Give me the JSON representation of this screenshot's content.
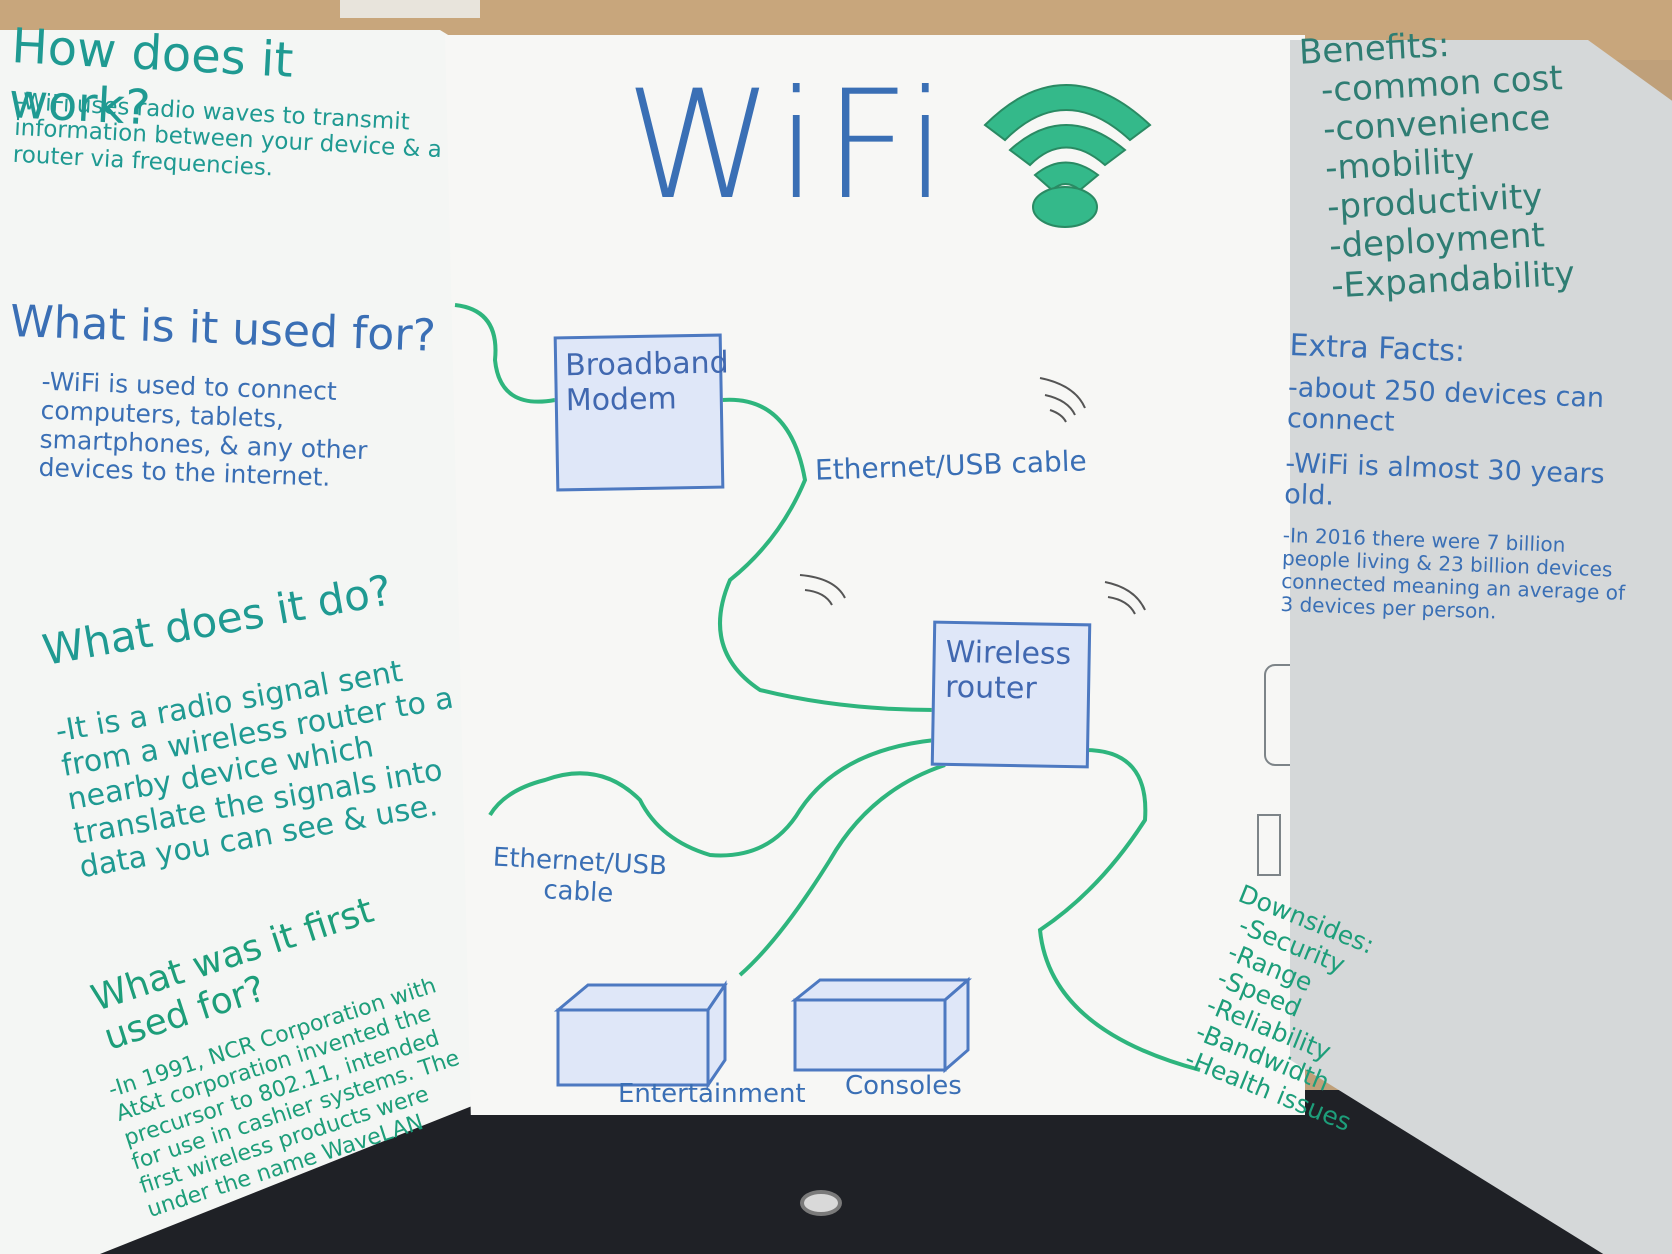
{
  "board": {
    "title": "WiFi",
    "left_panel": {
      "sections": [
        {
          "heading": "How does it work?",
          "body": "-WiFi uses radio waves to transmit information between your device & a router via frequencies."
        },
        {
          "heading": "What is it used for?",
          "body": "-WiFi is used to connect computers, tablets, smartphones, & any other devices to the internet."
        },
        {
          "heading": "What does it do?",
          "body": "-It is a radio signal sent from a wireless router to a nearby device which translate the signals into data you can see & use."
        },
        {
          "heading": "What was it first used for?",
          "body": "-In 1991, NCR Corporation with At&t corporation invented the precursor to 802.11, intended for use in cashier systems. The first wireless products were under the name WaveLAN"
        }
      ]
    },
    "diagram": {
      "nodes": [
        {
          "id": "modem",
          "label": "Broadband\nModem"
        },
        {
          "id": "router",
          "label": "Wireless\nrouter"
        },
        {
          "id": "entertainment",
          "label": "Entertainment"
        },
        {
          "id": "consoles",
          "label": "Consoles"
        }
      ],
      "cable_labels": [
        "Ethernet/USB cable",
        "Ethernet/USB\ncable"
      ]
    },
    "right_panel": {
      "benefits_heading": "Benefits:",
      "benefits": [
        "-common cost",
        "-convenience",
        "-mobility",
        "-productivity",
        "-deployment",
        "-Expandability"
      ],
      "extra_heading": "Extra Facts:",
      "extra_facts": [
        "-about 250 devices can connect",
        "-WiFi is almost 30 years old.",
        "-In 2016 there were 7 billion people living & 23 billion devices connected meaning an average of 3 devices per person."
      ],
      "downsides_heading": "Downsides:",
      "downsides": [
        "-Security",
        "-Range",
        "-Speed",
        "-Reliability",
        "-Bandwidth",
        "-Health issues"
      ]
    },
    "colors": {
      "title_blue": "#3a6fb5",
      "wifi_icon_green": "#34b98a",
      "cable_green": "#2eb57d",
      "text_teal": "#1f9a92"
    },
    "icons": [
      "wifi-icon",
      "smartphone-icon",
      "tv-icon",
      "desktop-icon",
      "speaker-icon",
      "printer-icon"
    ]
  }
}
